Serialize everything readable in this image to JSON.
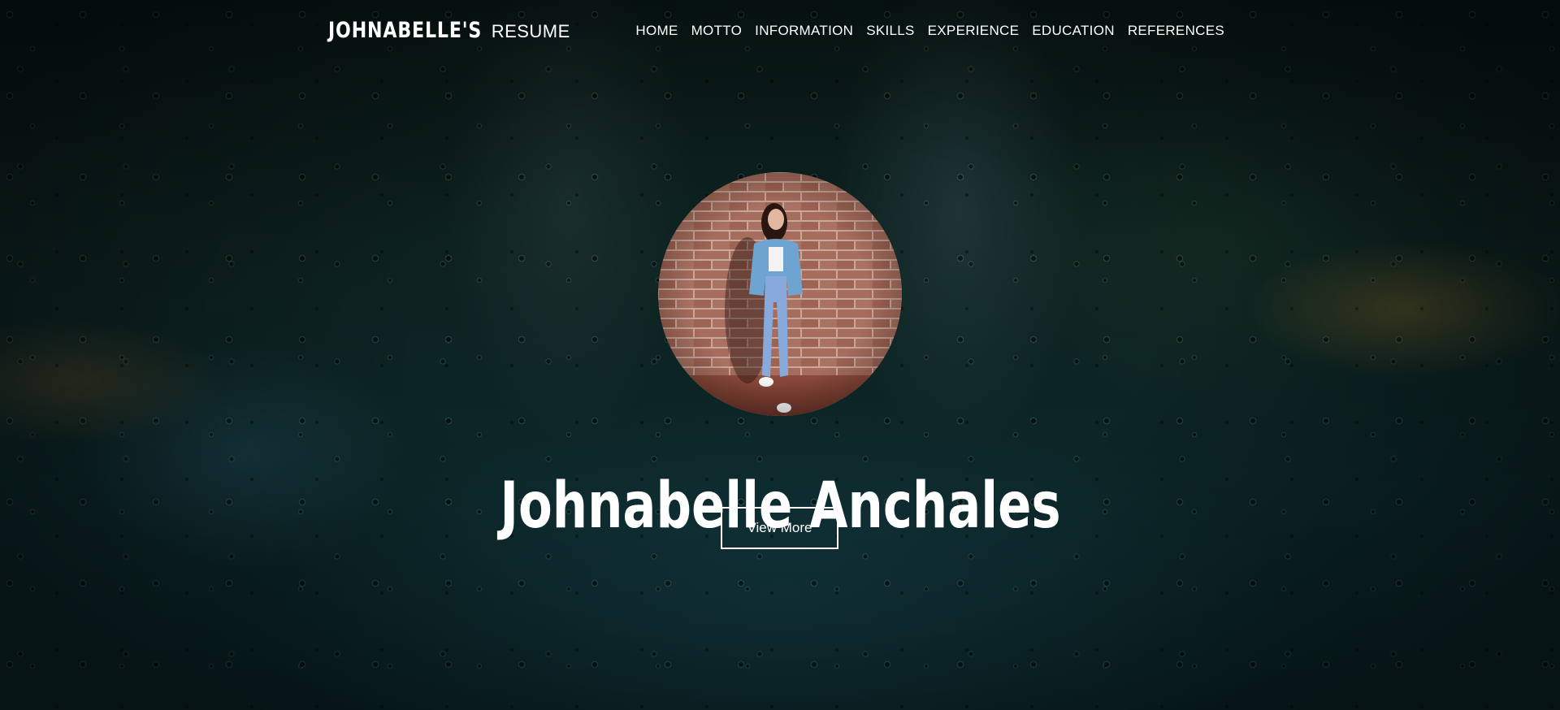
{
  "brand": {
    "name": "JOHNABELLE'S",
    "suffix": "RESUME"
  },
  "nav": {
    "items": [
      {
        "label": "HOME"
      },
      {
        "label": "MOTTO"
      },
      {
        "label": "INFORMATION"
      },
      {
        "label": "SKILLS"
      },
      {
        "label": "EXPERIENCE"
      },
      {
        "label": "EDUCATION"
      },
      {
        "label": "REFERENCES"
      }
    ]
  },
  "hero": {
    "name": "Johnabelle Anchales",
    "button_label": "View More",
    "avatar_icon": "profile-photo"
  },
  "colors": {
    "text": "#ffffff",
    "background": "#0c2325",
    "brick": "#a86e5e",
    "denim": "#6fa3d0"
  }
}
